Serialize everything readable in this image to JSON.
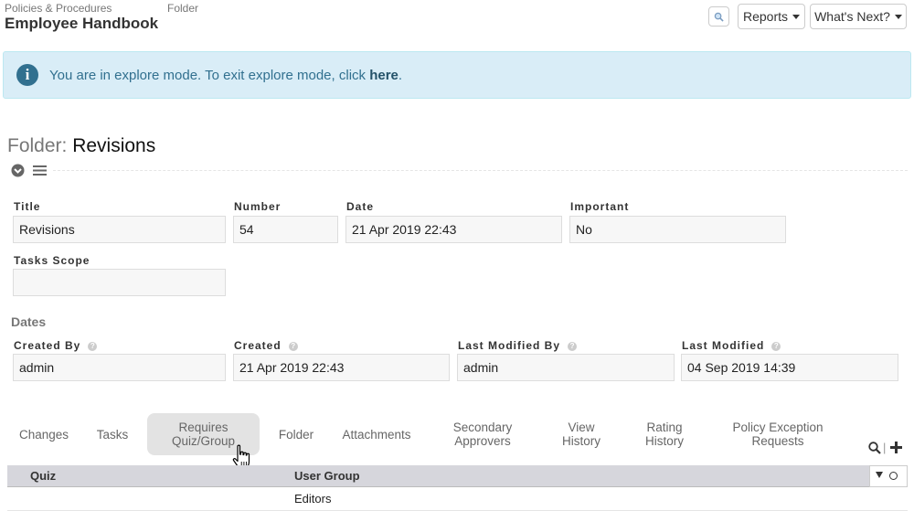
{
  "breadcrumb": {
    "parent": "Policies & Procedures",
    "type": "Folder"
  },
  "page_title": "Employee Handbook",
  "header_buttons": {
    "search_icon": "search-icon",
    "reports": "Reports",
    "whats_next": "What's Next?"
  },
  "alert": {
    "text_before": "You are in explore mode. To exit explore mode, click ",
    "link": "here",
    "text_after": ".",
    "icon": "info-icon"
  },
  "folder": {
    "label": "Folder:",
    "name": "Revisions"
  },
  "fields": {
    "title": {
      "label": "Title",
      "value": "Revisions"
    },
    "number": {
      "label": "Number",
      "value": "54"
    },
    "date": {
      "label": "Date",
      "value": "21 Apr 2019 22:43"
    },
    "important": {
      "label": "Important",
      "value": "No"
    },
    "tasks_scope": {
      "label": "Tasks Scope",
      "value": ""
    }
  },
  "dates": {
    "section_title": "Dates",
    "created_by": {
      "label": "Created By",
      "value": "admin"
    },
    "created": {
      "label": "Created",
      "value": "21 Apr 2019 22:43"
    },
    "last_modified_by": {
      "label": "Last Modified By",
      "value": "admin"
    },
    "last_modified": {
      "label": "Last Modified",
      "value": "04 Sep 2019 14:39"
    }
  },
  "tabs": [
    "Changes",
    "Tasks",
    "Requires\nQuiz/Group",
    "Folder",
    "Attachments",
    "Secondary\nApprovers",
    "View\nHistory",
    "Rating\nHistory",
    "Policy Exception\nRequests"
  ],
  "grid": {
    "columns": [
      "Quiz",
      "User Group"
    ],
    "rows": [
      [
        "",
        "Editors"
      ]
    ]
  }
}
